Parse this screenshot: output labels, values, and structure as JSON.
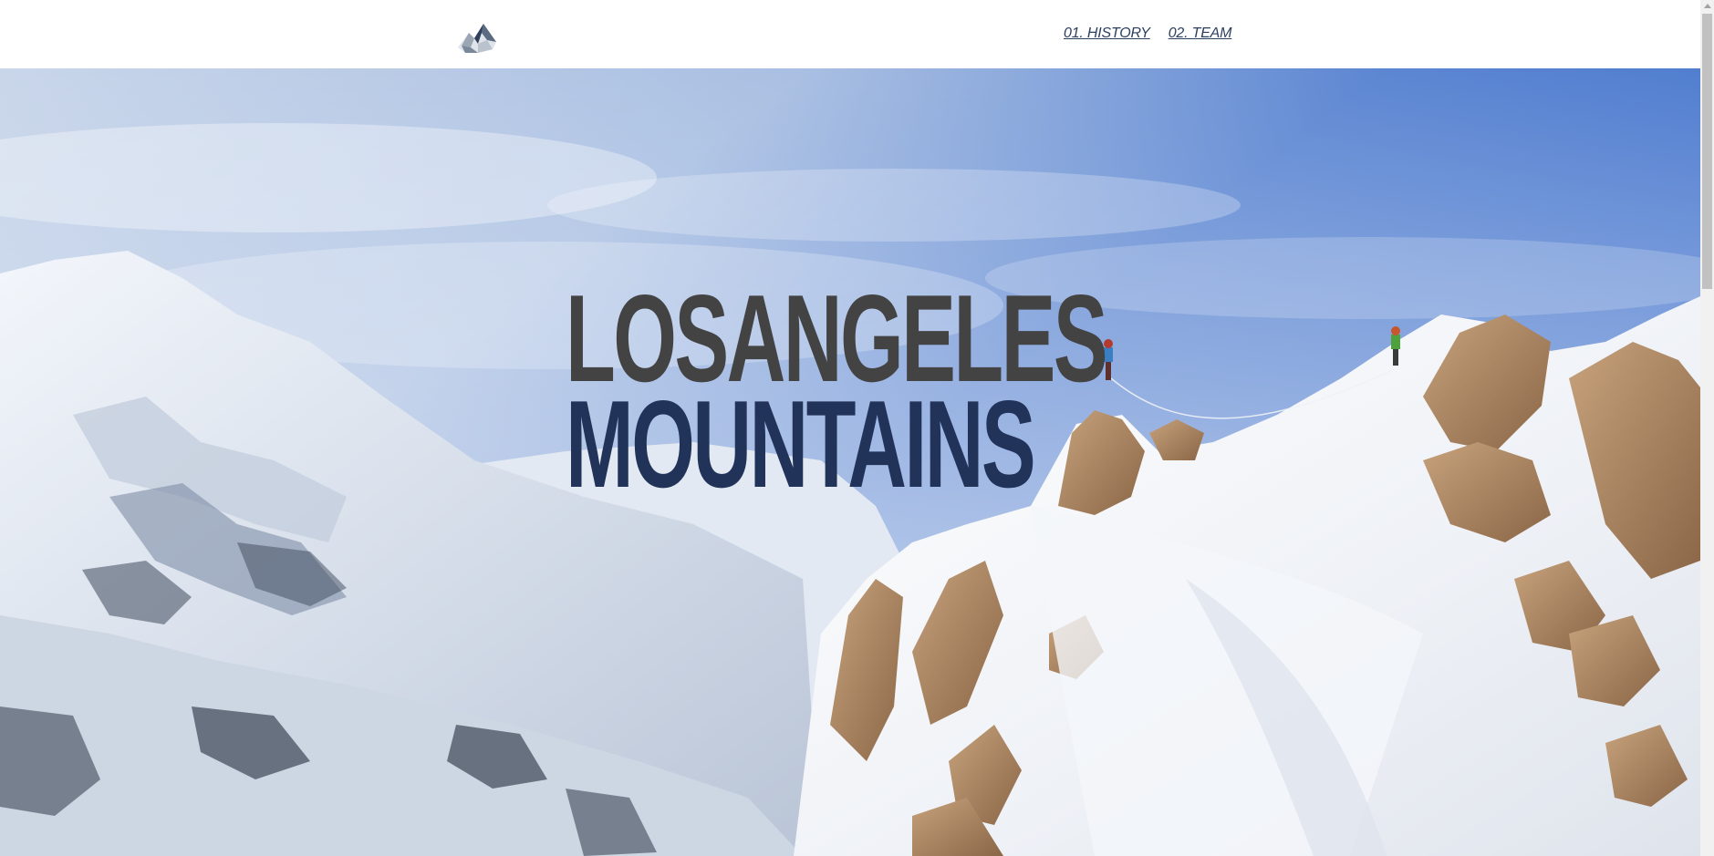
{
  "header": {
    "logo_icon": "mountain-peak-logo",
    "nav": [
      {
        "label": "01. HISTORY"
      },
      {
        "label": "02. TEAM"
      }
    ]
  },
  "hero": {
    "headline_line1": "LOSANGELES",
    "headline_line2": "MOUNTAINS",
    "background": "snowy mountain ridge with two climbers under a blue sky",
    "colors": {
      "line1": "#434343",
      "line2": "#22335a",
      "nav_link": "#2b3f5f"
    }
  }
}
